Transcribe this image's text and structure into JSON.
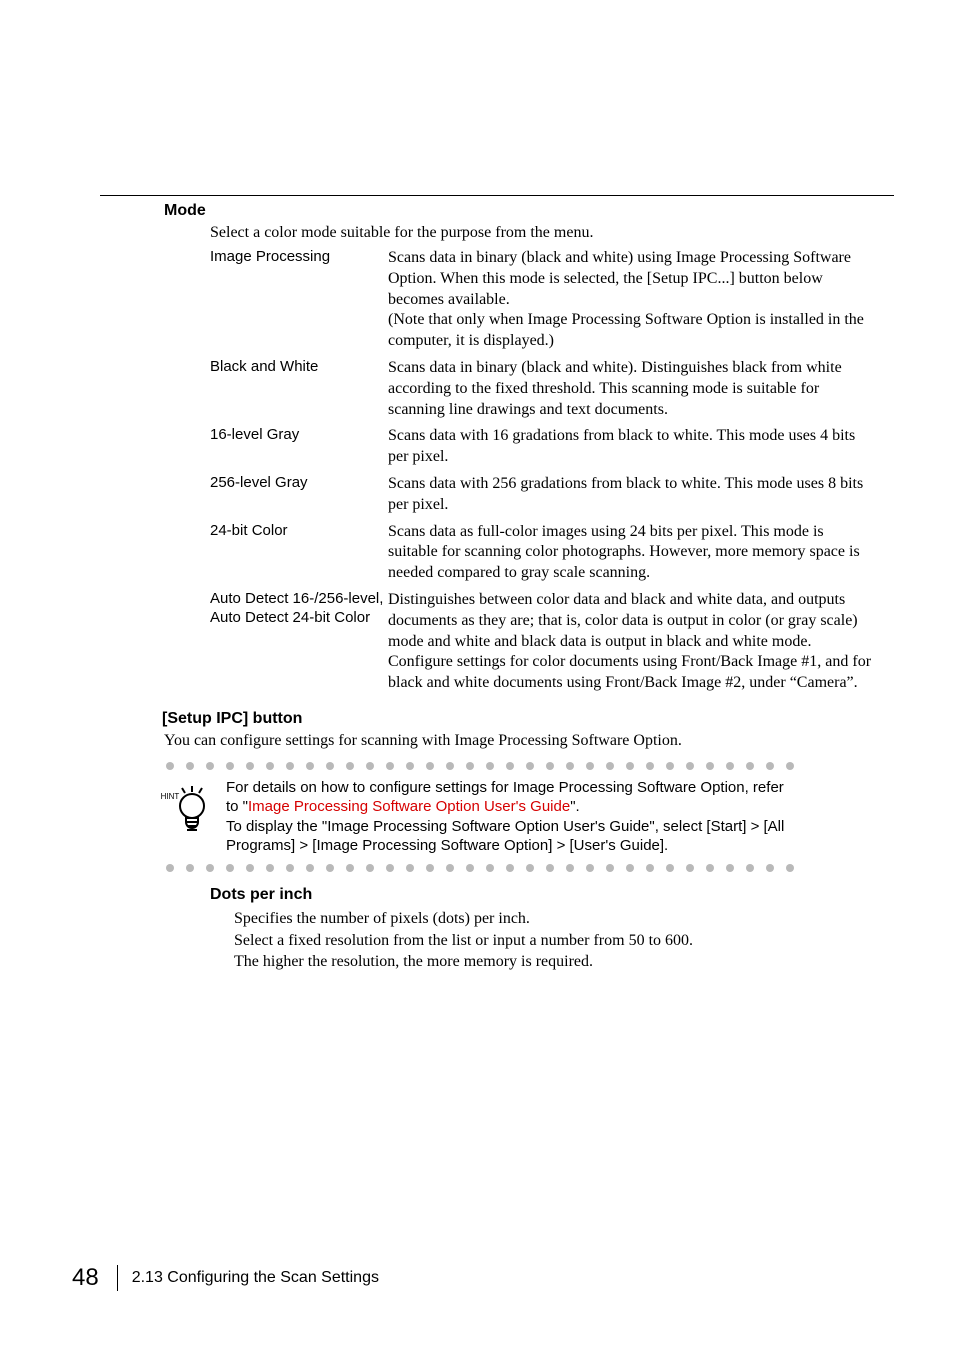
{
  "mode": {
    "heading": "Mode",
    "intro": "Select a color mode suitable for the purpose from the menu.",
    "items": [
      {
        "term": "Image Processing",
        "desc": "Scans data in binary (black and white) using Image Processing Software Option. When this mode is selected, the [Setup IPC...] button below becomes available.\n(Note that only when Image Processing Software Option is installed in the computer, it is displayed.)"
      },
      {
        "term": "Black and White",
        "desc": "Scans data in binary (black and white). Distinguishes black from white according to the fixed threshold. This scanning mode is suitable for scanning line drawings and text documents."
      },
      {
        "term": "16-level Gray",
        "desc": "Scans data with 16 gradations from black to white. This mode uses 4 bits per pixel."
      },
      {
        "term": "256-level Gray",
        "desc": "Scans data with 256 gradations from black to white. This mode uses 8 bits per pixel."
      },
      {
        "term": "24-bit Color",
        "desc": "Scans data as full-color images using 24 bits per pixel. This mode is suitable for scanning color photographs. However, more memory space is needed compared to gray scale scanning."
      },
      {
        "term": "Auto Detect 16-/256-level, Auto Detect 24-bit Color",
        "desc": "Distinguishes between color data and black and white data, and outputs documents as they are; that is, color data is output in color (or gray scale) mode and white and black data is output in black and white mode.\nConfigure settings for color documents using Front/Back Image #1, and for black and white documents using Front/Back Image #2, under “Camera”."
      }
    ]
  },
  "setupIpc": {
    "heading": "[Setup IPC] button",
    "desc": "You can configure settings for scanning with Image Processing Software Option."
  },
  "hint": {
    "label": "HINT",
    "text_before": "For details on how to configure settings for Image Processing Software Option, refer to \"",
    "link": "Image Processing Software Option User's Guide",
    "text_after": "\".\nTo display the \"Image Processing Software Option User's Guide\", select [Start] > [All Programs] > [Image Processing Software Option] > [User's Guide]."
  },
  "dotsPerInch": {
    "heading": "Dots per inch",
    "lines": [
      "Specifies the number of pixels (dots) per inch.",
      "Select a fixed resolution from the list or input a number from 50 to 600.",
      "The higher the resolution, the more memory is required."
    ]
  },
  "footer": {
    "pageNumber": "48",
    "section": "2.13 Configuring the Scan Settings"
  }
}
